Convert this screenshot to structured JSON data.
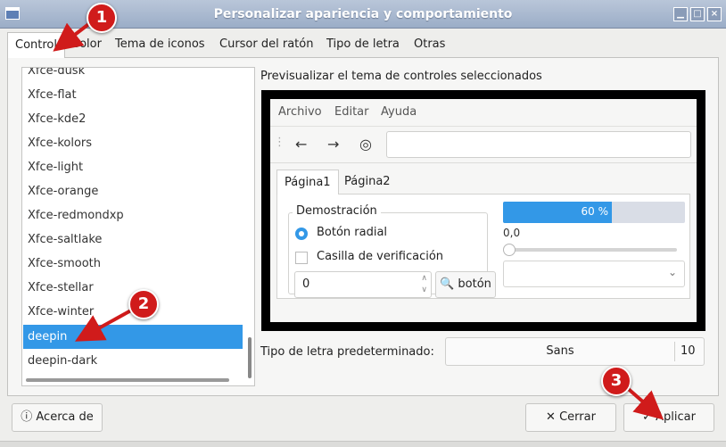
{
  "window": {
    "title": "Personalizar apariencia y comportamiento",
    "minimize_glyph": "▁",
    "maximize_glyph": "□",
    "close_glyph": "×"
  },
  "tabs": [
    "Control",
    "Color",
    "Tema de iconos",
    "Cursor del ratón",
    "Tipo de letra",
    "Otras"
  ],
  "theme_list": {
    "items": [
      "Xfce-dusk",
      "Xfce-flat",
      "Xfce-kde2",
      "Xfce-kolors",
      "Xfce-light",
      "Xfce-orange",
      "Xfce-redmondxp",
      "Xfce-saltlake",
      "Xfce-smooth",
      "Xfce-stellar",
      "Xfce-winter",
      "deepin",
      "deepin-dark"
    ],
    "selected": "deepin"
  },
  "preview": {
    "label": "Previsualizar el tema de controles seleccionados",
    "menu": [
      "Archivo",
      "Editar",
      "Ayuda"
    ],
    "tabs": [
      "Página1",
      "Página2"
    ],
    "group_title": "Demostración",
    "radio_label": "Botón radial",
    "check_label": "Casilla de verificación",
    "spin_value": "0",
    "search_button": "botón",
    "progress_percent": 60,
    "progress_text": "60 %",
    "slider_value": "0,0"
  },
  "font": {
    "label": "Tipo de letra predeterminado:",
    "name": "Sans",
    "size": "10"
  },
  "buttons": {
    "about": "Acerca de",
    "close": "Cerrar",
    "apply": "Aplicar"
  },
  "annotations": [
    "1",
    "2",
    "3"
  ],
  "colors": {
    "accent": "#3398e7",
    "badge": "#d01b1b"
  }
}
